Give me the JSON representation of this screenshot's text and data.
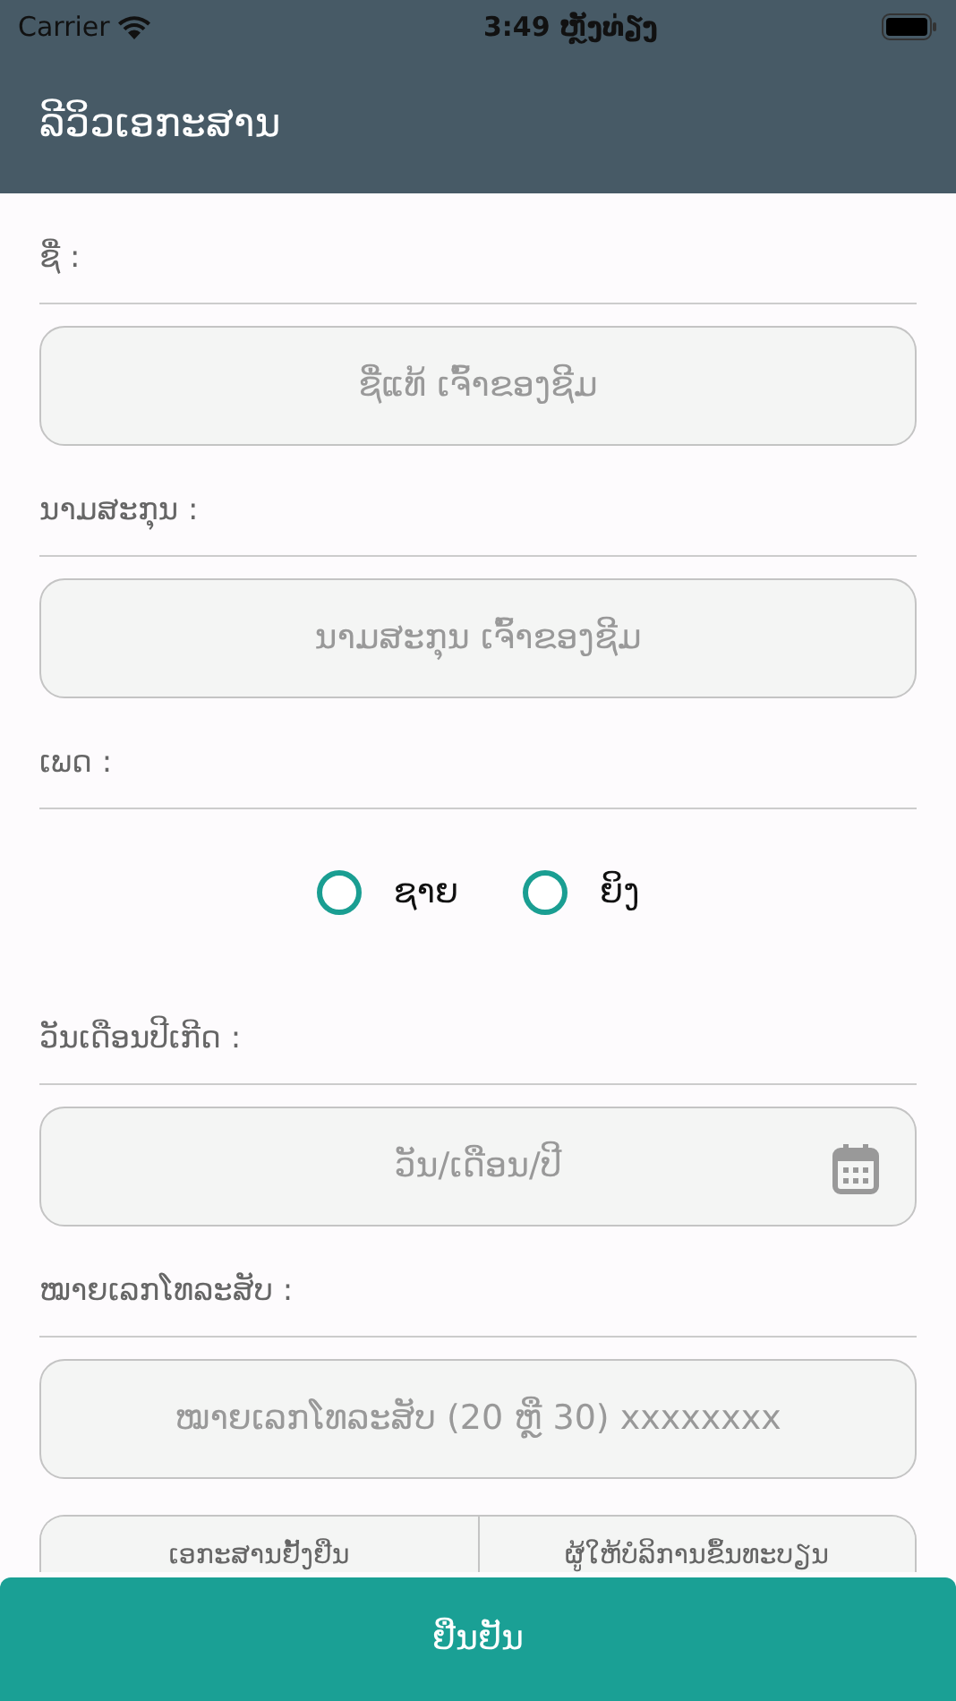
{
  "status_bar": {
    "carrier": "Carrier",
    "time": "3:49 ຫຼັງທ່ຽງ"
  },
  "header": {
    "title": "ລີວິວເອກະສານ"
  },
  "fields": [
    {
      "kind": "text",
      "label": "ຊື່ :",
      "placeholder": "ຊື່ແທ້ ເຈົ້າຂອງຊີມ"
    },
    {
      "kind": "text",
      "label": "ນາມສະກຸນ :",
      "placeholder": "ນາມສະກຸນ ເຈົ້າຂອງຊີມ"
    },
    {
      "kind": "radio",
      "label": "ເພດ :",
      "options": [
        {
          "label": "ຊາຍ",
          "selected": false
        },
        {
          "label": "ຍິງ",
          "selected": false
        }
      ]
    },
    {
      "kind": "date",
      "label": "ວັນເດືອນປີເກີດ :",
      "placeholder": "ວັນ/ເດືອນ/ປີ"
    },
    {
      "kind": "text",
      "label": "ໝາຍເລກໂທລະສັບ :",
      "placeholder": "ໝາຍເລກໂທລະສັບ (20 ຫຼື 30) xxxxxxxx"
    }
  ],
  "segments": [
    {
      "label": "ເອກະສານຢັ້ງຢືນ",
      "selected": false
    },
    {
      "label": "ຜູ້ໃຫ້ບໍລິການຂຶ້ນທະບຽນ",
      "selected": false
    }
  ],
  "confirm_button": "ຢືນຢັນ"
}
